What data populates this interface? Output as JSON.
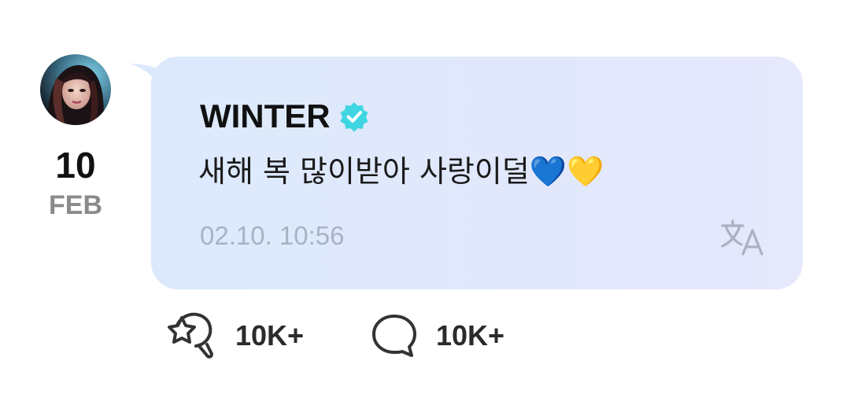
{
  "post": {
    "date_day": "10",
    "date_month": "FEB",
    "author": "WINTER",
    "verified": true,
    "message": "새해 복 많이받아 사랑이덜💙💛",
    "timestamp": "02.10. 10:56"
  },
  "actions": {
    "reactions_count": "10K+",
    "comments_count": "10K+"
  },
  "icons": {
    "avatar": "avatar",
    "verified": "verified-badge-icon",
    "translate": "translate-icon",
    "reaction": "reaction-icon",
    "comment": "comment-icon"
  },
  "colors": {
    "bubble_start": "#dce9fc",
    "bubble_end": "#e6e8fc",
    "verified": "#3fd6e2",
    "timestamp": "#a7b3c4",
    "month": "#8a8a8a"
  }
}
